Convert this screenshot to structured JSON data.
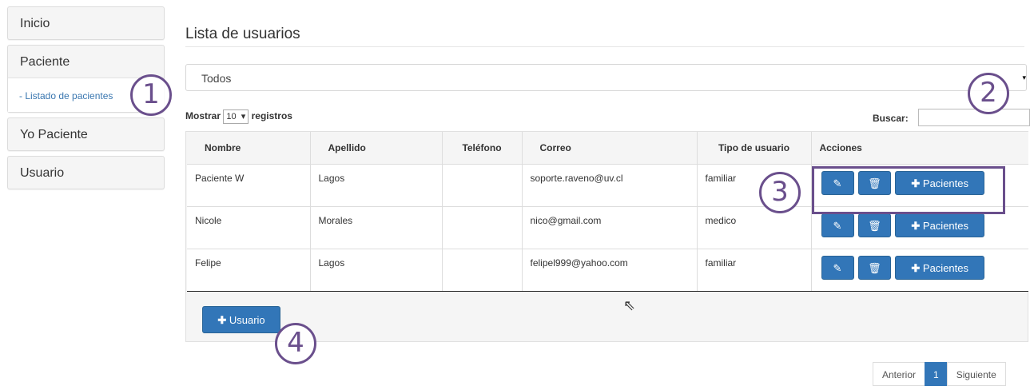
{
  "sidebar": {
    "items": [
      {
        "label": "Inicio"
      },
      {
        "label": "Paciente",
        "sub": "- Listado de pacientes"
      },
      {
        "label": "Yo Paciente"
      },
      {
        "label": "Usuario"
      }
    ]
  },
  "main": {
    "title": "Lista de usuarios",
    "filter": {
      "selected": "Todos",
      "caret": "▾"
    },
    "length": {
      "prefix": "Mostrar",
      "value": "10",
      "suffix": "registros"
    },
    "search": {
      "label": "Buscar:",
      "value": ""
    }
  },
  "table": {
    "headers": [
      "Nombre",
      "Apellido",
      "Teléfono",
      "Correo",
      "Tipo de usuario",
      "Acciones"
    ],
    "rows": [
      {
        "nombre": "Paciente W",
        "apellido": "Lagos",
        "telefono": "",
        "correo": "soporte.raveno@uv.cl",
        "tipo": "familiar"
      },
      {
        "nombre": "Nicole",
        "apellido": "Morales",
        "telefono": "",
        "correo": "nico@gmail.com",
        "tipo": "medico"
      },
      {
        "nombre": "Felipe",
        "apellido": "Lagos",
        "telefono": "",
        "correo": "felipel999@yahoo.com",
        "tipo": "familiar"
      }
    ],
    "actions": {
      "edit_icon": "pencil-icon",
      "delete_icon": "trash-icon",
      "pacientes_label": "Pacientes"
    }
  },
  "add_user_label": "Usuario",
  "pagination": {
    "prev": "Anterior",
    "current": "1",
    "next": "Siguiente"
  },
  "annotations": [
    "1",
    "2",
    "3",
    "4"
  ],
  "colors": {
    "primary": "#3276b8",
    "annotation": "#6a4f8c",
    "link": "#3a77b0"
  }
}
